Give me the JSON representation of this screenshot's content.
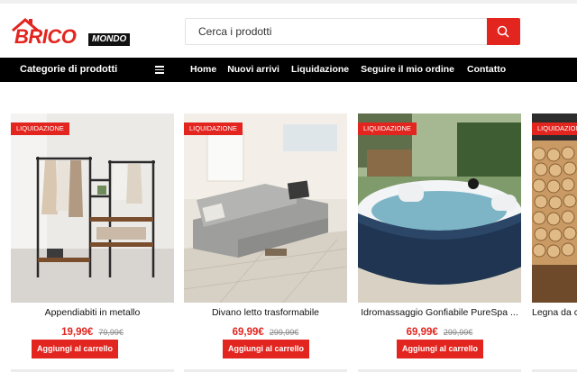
{
  "brand": {
    "name_part1": "BRICO",
    "name_part2": "MONDO",
    "colors": {
      "accent": "#e2251f",
      "dark": "#000000"
    }
  },
  "search": {
    "placeholder": "Cerca i prodotti",
    "icon": "search-icon"
  },
  "nav": {
    "categories_label": "Categorie di prodotti",
    "menu_icon": "hamburger-icon",
    "links": [
      "Home",
      "Nuovi arrivi",
      "Liquidazione",
      "Seguire il mio ordine",
      "Contatto"
    ]
  },
  "products": [
    {
      "badge": "LIQUIDAZIONE",
      "name": "Appendiabiti in metallo",
      "price": "19,99€",
      "old_price": "79,99€",
      "button": "Aggiungi al carrello"
    },
    {
      "badge": "LIQUIDAZIONE",
      "name": "Divano letto trasformabile",
      "price": "69,99€",
      "old_price": "299,99€",
      "button": "Aggiungi al carrello"
    },
    {
      "badge": "LIQUIDAZIONE",
      "name": "Idromassaggio Gonfiabile PureSpa ...",
      "price": "69,99€",
      "old_price": "299,99€",
      "button": "Aggiungi al carrello"
    },
    {
      "badge": "LIQUIDAZIONE",
      "name": "Legna da c",
      "price": "",
      "old_price": "",
      "button": ""
    }
  ]
}
